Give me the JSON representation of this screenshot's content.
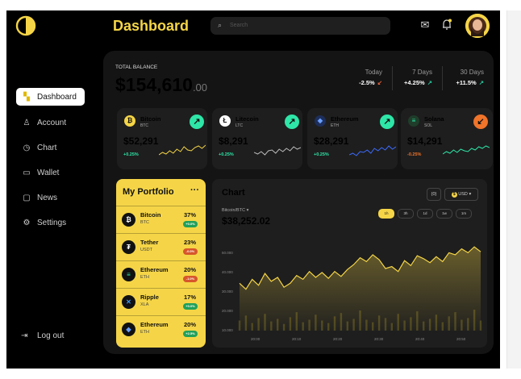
{
  "app": {
    "title": "Dashboard"
  },
  "search": {
    "placeholder": "Search"
  },
  "sidebar": {
    "items": [
      {
        "label": "Dashboard",
        "icon": "grid-icon",
        "glyph": "▚",
        "active": true
      },
      {
        "label": "Account",
        "icon": "user-icon",
        "glyph": "♙",
        "active": false
      },
      {
        "label": "Chart",
        "icon": "history-icon",
        "glyph": "◷",
        "active": false
      },
      {
        "label": "Wallet",
        "icon": "wallet-icon",
        "glyph": "▭",
        "active": false
      },
      {
        "label": "News",
        "icon": "news-icon",
        "glyph": "▢",
        "active": false
      },
      {
        "label": "Settings",
        "icon": "gear-icon",
        "glyph": "⚙",
        "active": false
      }
    ],
    "logout_label": "Log out"
  },
  "balance": {
    "label": "TOTAL BALANCE",
    "value": "$154,610",
    "cents": ".00"
  },
  "stats": [
    {
      "period": "Today",
      "change": "-2.5%",
      "arrow": "↙",
      "arrow_color": "#e8623a"
    },
    {
      "period": "7 Days",
      "change": "+4.25%",
      "arrow": "↗",
      "arrow_color": "#27c59a"
    },
    {
      "period": "30 Days",
      "change": "+11.5%",
      "arrow": "↗",
      "arrow_color": "#27c59a"
    }
  ],
  "coins": [
    {
      "name": "Bitcoin",
      "symbol": "BTC",
      "price": "$52,291",
      "change": "+0.25%",
      "glyph": "₿",
      "icon_bg": "#f5d547",
      "icon_fg": "#111",
      "arrow": "↗",
      "arrow_bg": "#2ee6a8",
      "change_color": "#2ee6a8",
      "line_color": "#f5d547"
    },
    {
      "name": "Litecoin",
      "symbol": "LTC",
      "price": "$8,291",
      "change": "+0.25%",
      "glyph": "Ł",
      "icon_bg": "#ffffff",
      "icon_fg": "#111",
      "arrow": "↗",
      "arrow_bg": "#2ee6a8",
      "change_color": "#2ee6a8",
      "line_color": "#bbbbbb"
    },
    {
      "name": "Ethereum",
      "symbol": "ETH",
      "price": "$28,291",
      "change": "+0.25%",
      "glyph": "◆",
      "icon_bg": "#1d2e5a",
      "icon_fg": "#6aa0ff",
      "arrow": "↗",
      "arrow_bg": "#2ee6a8",
      "change_color": "#2ee6a8",
      "line_color": "#3b6bff"
    },
    {
      "name": "Solana",
      "symbol": "SOL",
      "price": "$14,291",
      "change": "-0.25%",
      "glyph": "≡",
      "icon_bg": "#1f3d2a",
      "icon_fg": "#2ee6a8",
      "arrow": "↙",
      "arrow_bg": "#f0742a",
      "change_color": "#f0742a",
      "line_color": "#2ee6a8"
    }
  ],
  "portfolio": {
    "title": "My Portfolio",
    "menu": "···",
    "items": [
      {
        "name": "Bitcoin",
        "symbol": "BTC",
        "percent": "37%",
        "badge": "+0.0%",
        "badge_color": "#22a05a",
        "glyph": "₿"
      },
      {
        "name": "Tether",
        "symbol": "USDT",
        "percent": "23%",
        "badge": "-0.0%",
        "badge_color": "#d7562b",
        "glyph": "₮"
      },
      {
        "name": "Ethereum",
        "symbol": "ETH",
        "percent": "20%",
        "badge": "-1.0%",
        "badge_color": "#d7562b",
        "glyph": "≡",
        "glyph_color": "#2ee6a8"
      },
      {
        "name": "Ripple",
        "symbol": "XLA",
        "percent": "17%",
        "badge": "+0.0%",
        "badge_color": "#22a05a",
        "glyph": "✕",
        "glyph_color": "#3b9bff"
      },
      {
        "name": "Ethereum",
        "symbol": "ETH",
        "percent": "20%",
        "badge": "+2.5%",
        "badge_color": "#22a05a",
        "glyph": "◆",
        "glyph_color": "#6aa0ff"
      }
    ]
  },
  "chart": {
    "title": "Chart",
    "pair": "Bitcoin/BTC",
    "price": "$38,252.02",
    "toggle_label": "{0}",
    "currency_label": "USD",
    "ranges": [
      "1h",
      "3h",
      "1d",
      "1w",
      "1m"
    ],
    "active_range": "1h"
  },
  "chart_data": {
    "type": "area",
    "x_ticks": [
      "20:00",
      "20:10",
      "20:20",
      "20:30",
      "20:40",
      "20:50"
    ],
    "y_ticks": [
      "50.000",
      "40.000",
      "30.000",
      "20.000",
      "10.000"
    ],
    "ylim": [
      10000,
      55000
    ],
    "line_color": "#f5d547",
    "values": [
      34000,
      31000,
      36000,
      33000,
      39000,
      35000,
      37000,
      32000,
      34000,
      38000,
      36000,
      40000,
      37000,
      39500,
      36500,
      40000,
      37500,
      41000,
      43500,
      47000,
      45000,
      48500,
      46000,
      41500,
      42500,
      40000,
      45500,
      43000,
      48000,
      46500,
      44500,
      47500,
      45000,
      49500,
      48500,
      51500,
      49500,
      52500,
      50000
    ],
    "volume": [
      12,
      18,
      9,
      15,
      20,
      11,
      14,
      8,
      16,
      22,
      10,
      13,
      19,
      12,
      9,
      17,
      21,
      11,
      14,
      24,
      13,
      10,
      18,
      15,
      9,
      20,
      12,
      16,
      23,
      11,
      14,
      19,
      10,
      17,
      22,
      13,
      15,
      25,
      12
    ]
  },
  "colors": {
    "accent": "#f5d547",
    "background": "#000000",
    "panel": "#141414",
    "card": "#1e1e1e"
  }
}
